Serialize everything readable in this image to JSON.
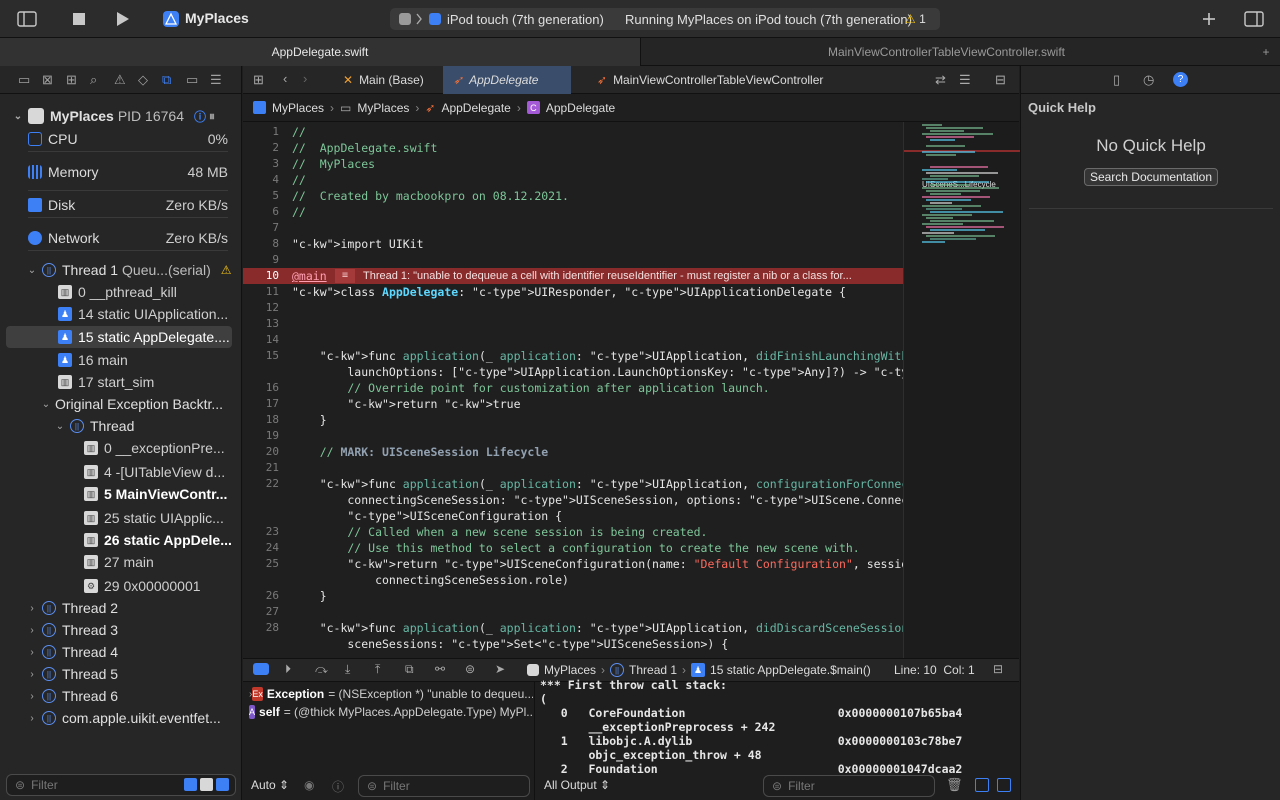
{
  "toolbar": {
    "app_name": "MyPlaces",
    "device": "iPod touch (7th generation)",
    "status": "Running MyPlaces on iPod touch (7th generation)",
    "warning_count": "1"
  },
  "file_tabs": [
    "AppDelegate.swift",
    "MainViewControllerTableViewController.swift"
  ],
  "navigator": {
    "process": {
      "name": "MyPlaces",
      "pid": "PID 16764"
    },
    "gauges": [
      {
        "label": "CPU",
        "value": "0%",
        "color": "#3d7ff5"
      },
      {
        "label": "Memory",
        "value": "48 MB",
        "color": "#3d7ff5"
      },
      {
        "label": "Disk",
        "value": "Zero KB/s",
        "color": "#3d7ff5"
      },
      {
        "label": "Network",
        "value": "Zero KB/s",
        "color": "#3d7ff5"
      }
    ],
    "thread1": {
      "name": "Thread 1",
      "queue": "Queu...(serial)"
    },
    "thread1_frames": [
      {
        "label": "0 __pthread_kill",
        "icon": "library-icon"
      },
      {
        "label": "14 static UIApplication...",
        "icon": "user-code-icon"
      },
      {
        "label": "15 static AppDelegate....",
        "icon": "user-code-icon"
      },
      {
        "label": "16 main",
        "icon": "user-code-icon"
      },
      {
        "label": "17 start_sim",
        "icon": "library-icon"
      }
    ],
    "original_exception": "Original Exception Backtr...",
    "exception_thread": "Thread",
    "exception_frames": [
      {
        "label": "0 __exceptionPre...",
        "icon": "library-icon"
      },
      {
        "label": "4 -[UITableView d...",
        "icon": "library-icon"
      },
      {
        "label": "5 MainViewContr...",
        "icon": "library-icon"
      },
      {
        "label": "25 static UIApplic...",
        "icon": "library-icon"
      },
      {
        "label": "26 static AppDele...",
        "icon": "library-icon"
      },
      {
        "label": "27 main",
        "icon": "library-icon"
      },
      {
        "label": "29 0x00000001",
        "icon": "gear-icon"
      }
    ],
    "other_threads": [
      "Thread 2",
      "Thread 3",
      "Thread 4",
      "Thread 5",
      "Thread 6",
      "com.apple.uikit.eventfet..."
    ],
    "filter_placeholder": "Filter"
  },
  "editor_tabs": [
    "Main (Base)",
    "AppDelegate",
    "MainViewControllerTableViewController"
  ],
  "breadcrumb": [
    "MyPlaces",
    "MyPlaces",
    "AppDelegate",
    "AppDelegate"
  ],
  "code_lines": [
    {
      "n": "1",
      "t": "//",
      "c": "comment"
    },
    {
      "n": "2",
      "t": "//  AppDelegate.swift",
      "c": "comment"
    },
    {
      "n": "3",
      "t": "//  MyPlaces",
      "c": "comment"
    },
    {
      "n": "4",
      "t": "//",
      "c": "comment"
    },
    {
      "n": "5",
      "t": "//  Created by macbookpro on 08.12.2021.",
      "c": "comment"
    },
    {
      "n": "6",
      "t": "//",
      "c": "comment"
    },
    {
      "n": "7",
      "t": "",
      "c": ""
    },
    {
      "n": "8",
      "t": "import UIKit",
      "c": "import"
    },
    {
      "n": "9",
      "t": "",
      "c": ""
    },
    {
      "n": "10",
      "t": "@main",
      "c": "error"
    },
    {
      "n": "11",
      "t": "class AppDelegate: UIResponder, UIApplicationDelegate {",
      "c": "class"
    },
    {
      "n": "12",
      "t": "",
      "c": ""
    },
    {
      "n": "13",
      "t": "",
      "c": ""
    },
    {
      "n": "14",
      "t": "",
      "c": ""
    },
    {
      "n": "15",
      "t": "    func application(_ application: UIApplication, didFinishLaunchingWithOptions",
      "c": "func"
    },
    {
      "n": "",
      "t": "        launchOptions: [UIApplication.LaunchOptionsKey: Any]?) -> Bool {",
      "c": "plain"
    },
    {
      "n": "16",
      "t": "        // Override point for customization after application launch.",
      "c": "comment"
    },
    {
      "n": "17",
      "t": "        return true",
      "c": "kw"
    },
    {
      "n": "18",
      "t": "    }",
      "c": "plain"
    },
    {
      "n": "19",
      "t": "",
      "c": ""
    },
    {
      "n": "20",
      "t": "    // MARK: UISceneSession Lifecycle",
      "c": "mark"
    },
    {
      "n": "21",
      "t": "",
      "c": ""
    },
    {
      "n": "22",
      "t": "    func application(_ application: UIApplication, configurationForConnecting",
      "c": "func"
    },
    {
      "n": "",
      "t": "        connectingSceneSession: UISceneSession, options: UIScene.ConnectionOptions) ->",
      "c": "plain"
    },
    {
      "n": "",
      "t": "        UISceneConfiguration {",
      "c": "type"
    },
    {
      "n": "23",
      "t": "        // Called when a new scene session is being created.",
      "c": "comment"
    },
    {
      "n": "24",
      "t": "        // Use this method to select a configuration to create the new scene with.",
      "c": "comment"
    },
    {
      "n": "25",
      "t": "        return UISceneConfiguration(name: \"Default Configuration\", sessionRole:",
      "c": "return-str"
    },
    {
      "n": "",
      "t": "            connectingSceneSession.role)",
      "c": "plain"
    },
    {
      "n": "26",
      "t": "    }",
      "c": "plain"
    },
    {
      "n": "27",
      "t": "",
      "c": ""
    },
    {
      "n": "28",
      "t": "    func application(_ application: UIApplication, didDiscardSceneSessions",
      "c": "func"
    },
    {
      "n": "",
      "t": "        sceneSessions: Set<UISceneSession>) {",
      "c": "plain"
    }
  ],
  "error_message": "Thread 1: \"unable to dequeue a cell with identifier reuseIdentifier - must register a nib or a class for...",
  "minimap_label": "UIScenеS...Lifecycle",
  "debug_bar": {
    "app": "MyPlaces",
    "thread": "Thread 1",
    "frame": "15 static AppDelegate.$main()",
    "position": "Line: 10  Col: 1"
  },
  "variables": [
    {
      "badge": "Ex",
      "name": "Exception",
      "value": "= (NSException *) \"unable to dequeu..."
    },
    {
      "badge": "A",
      "name": "self",
      "value": "= (@thick MyPlaces.AppDelegate.Type) MyPl..."
    }
  ],
  "console_lines": [
    "*** First throw call stack:",
    "(",
    "   0   CoreFoundation                      0x0000000107b65ba4",
    "       __exceptionPreprocess + 242",
    "   1   libobjc.A.dylib                     0x0000000103c78be7",
    "       objc_exception_throw + 48",
    "   2   Foundation                          0x00000001047dcaa2"
  ],
  "bottom": {
    "auto_label": "Auto",
    "var_filter": "Filter",
    "output_label": "All Output",
    "console_filter": "Filter"
  },
  "inspector": {
    "title": "Quick Help",
    "empty": "No Quick Help",
    "search_button": "Search Documentation"
  }
}
